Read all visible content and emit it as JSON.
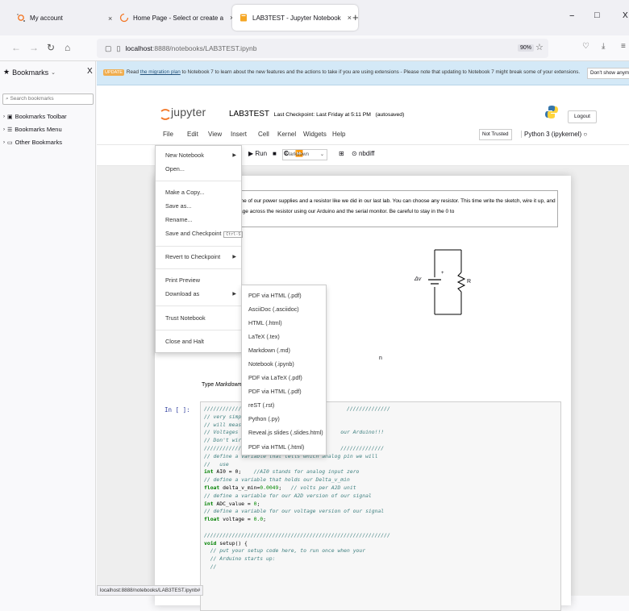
{
  "browser": {
    "tabs": [
      {
        "label": "My account"
      },
      {
        "label": "Home Page - Select or create a..."
      },
      {
        "label": "LAB3TEST - Jupyter Notebook"
      }
    ],
    "new_tab": "+",
    "url_host": "localhost",
    "url_path": ":8888/notebooks/LAB3TEST.ipynb",
    "zoom": "90%",
    "window_min": "−",
    "window_max": "□",
    "window_close": "X"
  },
  "sidebar": {
    "title": "Bookmarks",
    "search_placeholder": "Search bookmarks",
    "items": [
      "Bookmarks Toolbar",
      "Bookmarks Menu",
      "Other Bookmarks"
    ]
  },
  "banner": {
    "tag": "UPDATE",
    "text_pre": "Read ",
    "link": "the migration plan",
    "text_post": " to Notebook 7 to learn about the new features and the actions to take if you are using extensions - Please note that updating to Notebook 7 might break some of your extensions.",
    "button": "Don't show anymore"
  },
  "jupyter": {
    "logo_text": "jupyter",
    "notebook_name": "LAB3TEST",
    "checkpoint": "Last Checkpoint: Last Friday at 5:11 PM",
    "autosave": "(autosaved)",
    "logout": "Logout",
    "menus": [
      "File",
      "Edit",
      "View",
      "Insert",
      "Cell",
      "Kernel",
      "Widgets",
      "Help"
    ],
    "not_trusted": "Not Trusted",
    "kernel": "Python 3 (ipykernel)",
    "toolbar": {
      "run": "Run",
      "cell_type": "Markdown",
      "nbdiff": "nbdiff"
    }
  },
  "file_menu": {
    "items": [
      {
        "label": "New Notebook"
      },
      {
        "label": "Open..."
      },
      {
        "label": "Make a Copy..."
      },
      {
        "label": "Save as..."
      },
      {
        "label": "Rename..."
      },
      {
        "label": "Save and Checkpoint",
        "shortcut": "Ctrl-S"
      },
      {
        "label": "Revert to Checkpoint"
      },
      {
        "label": "Print Preview"
      },
      {
        "label": "Download as"
      },
      {
        "label": "Trust Notebook"
      },
      {
        "label": "Close and Halt"
      }
    ]
  },
  "download_menu": {
    "items": [
      "PDF via HTML (.pdf)",
      "AsciiDoc (.asciidoc)",
      "HTML (.html)",
      "LaTeX (.tex)",
      "Markdown (.md)",
      "Notebook (.ipynb)",
      "PDF via LaTeX (.pdf)",
      "PDF via HTML (.pdf)",
      "reST (.rst)",
      "Python (.py)",
      "Reveal.js slides (.slides.html)",
      "PDF via HTML (.html)"
    ]
  },
  "notebook": {
    "markdown_text": "ild a circuit with one of our power supplies and a resistor like we did in our last lab. You can choose any resistor. This time write the sketch, wire it up, and measure the voltage across the resistor using our Arduino and the serial monitor. Be careful to stay in the 0 to",
    "circuit_dv": "Δv",
    "circuit_plus": "+",
    "circuit_r": "R",
    "tail_text": "n",
    "type_markdown_pre": "Type ",
    "type_markdown_em": "Markdown",
    "prompt": "In [ ]:"
  },
  "status_link": "localhost:8888/notebooks/LAB3TEST.ipynb#"
}
